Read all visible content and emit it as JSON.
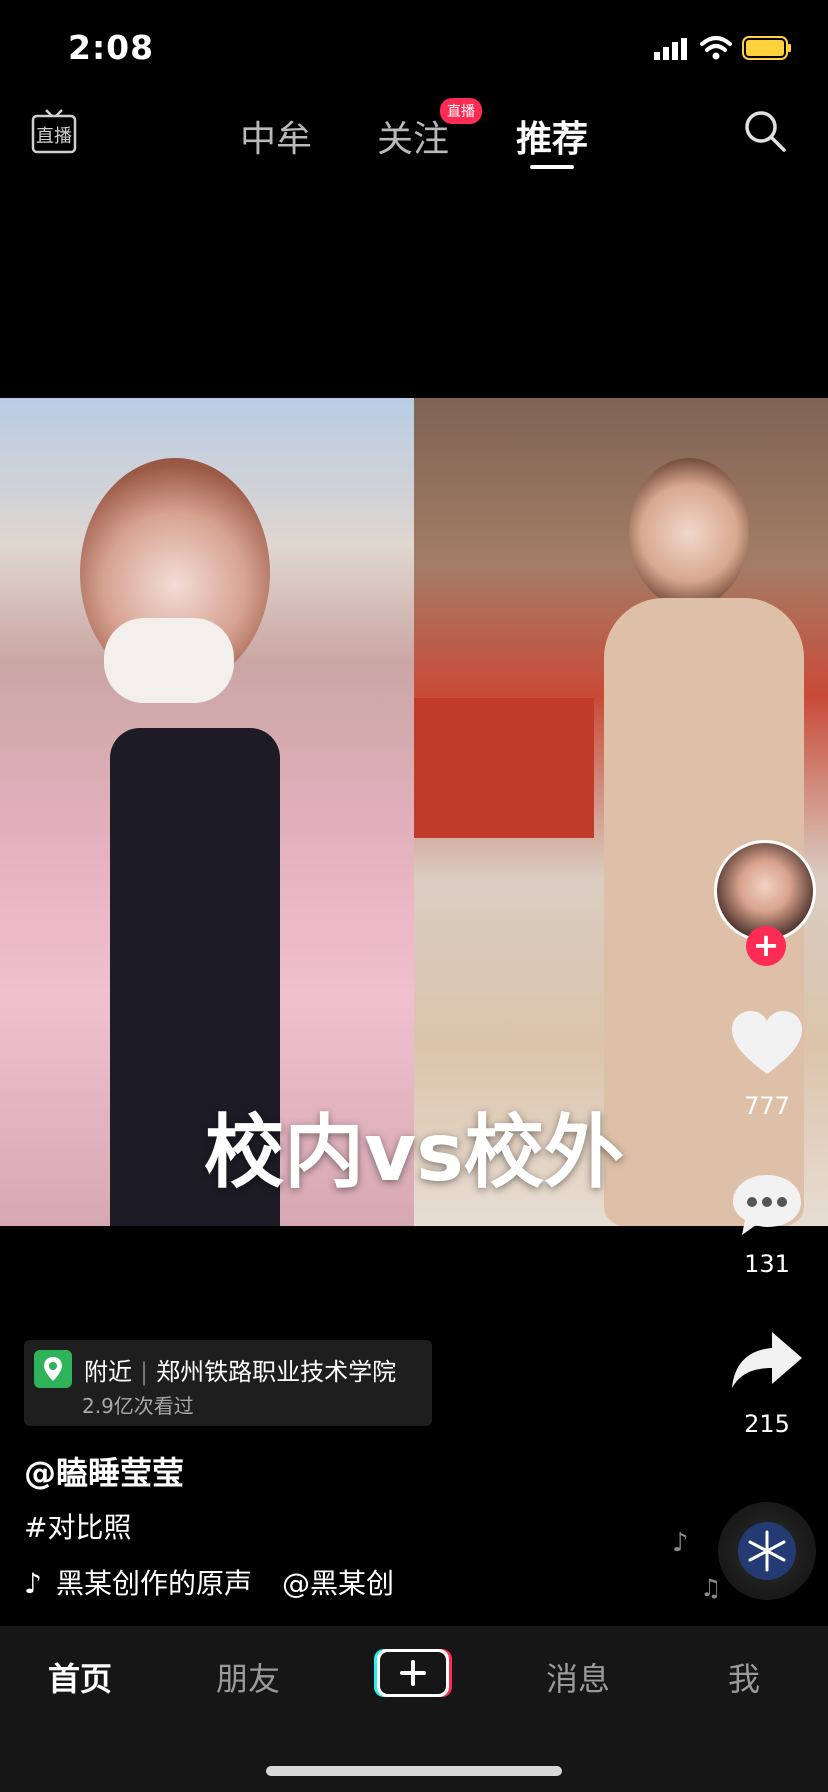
{
  "status_bar": {
    "time": "2:08"
  },
  "top_nav": {
    "live_icon_label": "直播",
    "tabs": [
      {
        "label": "中牟"
      },
      {
        "label": "关注",
        "badge": "直播"
      },
      {
        "label": "推荐",
        "active": true
      }
    ]
  },
  "video": {
    "overlay_text": "校内vs校外"
  },
  "actions": {
    "likes": "777",
    "comments": "131",
    "shares": "215"
  },
  "info": {
    "location_tag": "附近",
    "location_name": "郑州铁路职业技术学院",
    "location_views": "2.9亿次看过",
    "author": "@瞌睡莹莹",
    "hashtag": "#对比照",
    "music_text": "黑某创作的原声",
    "music_author": "@黑某创"
  },
  "bottom_tabs": {
    "home": "首页",
    "friends": "朋友",
    "messages": "消息",
    "me": "我"
  },
  "colors": {
    "accent": "#fe2c55",
    "location_pin": "#2fb35a",
    "battery": "#ffd23c"
  }
}
